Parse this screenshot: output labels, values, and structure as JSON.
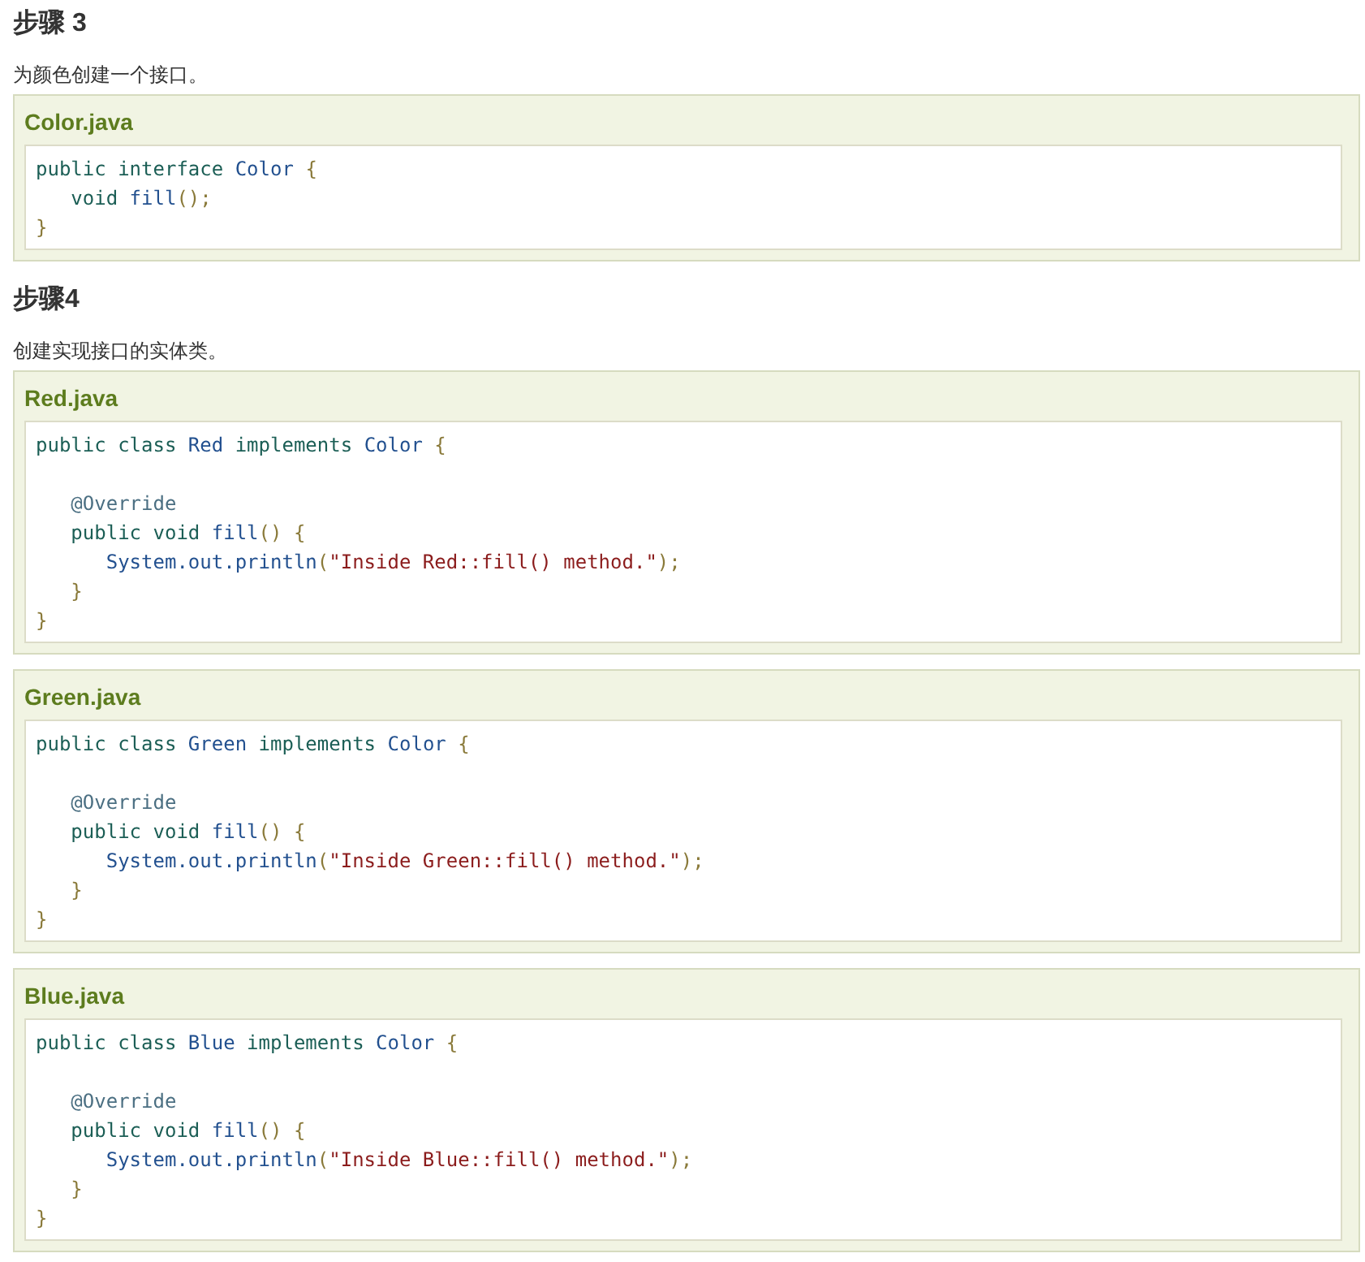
{
  "sections": [
    {
      "heading": "步骤 3",
      "text": "为颜色创建一个接口。",
      "examples": [
        {
          "title": "Color.java",
          "lines": [
            {
              "kind": "code",
              "tokens": [
                {
                  "kind": "kwd",
                  "text": "public interface "
                },
                {
                  "kind": "typ",
                  "text": "Color "
                },
                {
                  "kind": "pun",
                  "text": "{"
                }
              ],
              "children": [
                {
                  "kind": "code",
                  "tokens": [
                    {
                      "kind": "kwd",
                      "text": "void "
                    },
                    {
                      "kind": "typ",
                      "text": "fill"
                    },
                    {
                      "kind": "pun",
                      "text": "();"
                    }
                  ]
                }
              ]
            },
            {
              "kind": "code",
              "tokens": [
                {
                  "kind": "pun",
                  "text": "}"
                }
              ]
            }
          ]
        }
      ]
    },
    {
      "heading": "步骤4",
      "text": "创建实现接口的实体类。",
      "examples": [
        {
          "title": "Red.java",
          "lines": [
            {
              "kind": "code",
              "tokens": [
                {
                  "kind": "kwd",
                  "text": "public class "
                },
                {
                  "kind": "typ",
                  "text": "Red "
                },
                {
                  "kind": "kwd",
                  "text": "implements "
                },
                {
                  "kind": "typ",
                  "text": "Color "
                },
                {
                  "kind": "pun",
                  "text": "{"
                }
              ],
              "children": [
                {
                  "kind": "blank"
                },
                {
                  "kind": "code",
                  "tokens": [
                    {
                      "kind": "ann",
                      "text": "@Override"
                    }
                  ]
                },
                {
                  "kind": "code",
                  "tokens": [
                    {
                      "kind": "kwd",
                      "text": "public void "
                    },
                    {
                      "kind": "typ",
                      "text": "fill"
                    },
                    {
                      "kind": "pun",
                      "text": "() {"
                    }
                  ],
                  "children": [
                    {
                      "kind": "code",
                      "tokens": [
                        {
                          "kind": "typ",
                          "text": "System.out.println"
                        },
                        {
                          "kind": "pun",
                          "text": "("
                        },
                        {
                          "kind": "str",
                          "text": "\"Inside Red::fill() method.\""
                        },
                        {
                          "kind": "pun",
                          "text": ");"
                        }
                      ]
                    }
                  ]
                },
                {
                  "kind": "code",
                  "tokens": [
                    {
                      "kind": "pun",
                      "text": "}"
                    }
                  ]
                }
              ]
            },
            {
              "kind": "code",
              "tokens": [
                {
                  "kind": "pun",
                  "text": "}"
                }
              ]
            }
          ]
        },
        {
          "title": "Green.java",
          "lines": [
            {
              "kind": "code",
              "tokens": [
                {
                  "kind": "kwd",
                  "text": "public class "
                },
                {
                  "kind": "typ",
                  "text": "Green "
                },
                {
                  "kind": "kwd",
                  "text": "implements "
                },
                {
                  "kind": "typ",
                  "text": "Color "
                },
                {
                  "kind": "pun",
                  "text": "{"
                }
              ],
              "children": [
                {
                  "kind": "blank"
                },
                {
                  "kind": "code",
                  "tokens": [
                    {
                      "kind": "ann",
                      "text": "@Override"
                    }
                  ]
                },
                {
                  "kind": "code",
                  "tokens": [
                    {
                      "kind": "kwd",
                      "text": "public void "
                    },
                    {
                      "kind": "typ",
                      "text": "fill"
                    },
                    {
                      "kind": "pun",
                      "text": "() {"
                    }
                  ],
                  "children": [
                    {
                      "kind": "code",
                      "tokens": [
                        {
                          "kind": "typ",
                          "text": "System.out.println"
                        },
                        {
                          "kind": "pun",
                          "text": "("
                        },
                        {
                          "kind": "str",
                          "text": "\"Inside Green::fill() method.\""
                        },
                        {
                          "kind": "pun",
                          "text": ");"
                        }
                      ]
                    }
                  ]
                },
                {
                  "kind": "code",
                  "tokens": [
                    {
                      "kind": "pun",
                      "text": "}"
                    }
                  ]
                }
              ]
            },
            {
              "kind": "code",
              "tokens": [
                {
                  "kind": "pun",
                  "text": "}"
                }
              ]
            }
          ]
        },
        {
          "title": "Blue.java",
          "lines": [
            {
              "kind": "code",
              "tokens": [
                {
                  "kind": "kwd",
                  "text": "public class "
                },
                {
                  "kind": "typ",
                  "text": "Blue "
                },
                {
                  "kind": "kwd",
                  "text": "implements "
                },
                {
                  "kind": "typ",
                  "text": "Color "
                },
                {
                  "kind": "pun",
                  "text": "{"
                }
              ],
              "children": [
                {
                  "kind": "blank"
                },
                {
                  "kind": "code",
                  "tokens": [
                    {
                      "kind": "ann",
                      "text": "@Override"
                    }
                  ]
                },
                {
                  "kind": "code",
                  "tokens": [
                    {
                      "kind": "kwd",
                      "text": "public void "
                    },
                    {
                      "kind": "typ",
                      "text": "fill"
                    },
                    {
                      "kind": "pun",
                      "text": "() {"
                    }
                  ],
                  "children": [
                    {
                      "kind": "code",
                      "tokens": [
                        {
                          "kind": "typ",
                          "text": "System.out.println"
                        },
                        {
                          "kind": "pun",
                          "text": "("
                        },
                        {
                          "kind": "str",
                          "text": "\"Inside Blue::fill() method.\""
                        },
                        {
                          "kind": "pun",
                          "text": ");"
                        }
                      ]
                    }
                  ]
                },
                {
                  "kind": "code",
                  "tokens": [
                    {
                      "kind": "pun",
                      "text": "}"
                    }
                  ]
                }
              ]
            },
            {
              "kind": "code",
              "tokens": [
                {
                  "kind": "pun",
                  "text": "}"
                }
              ]
            }
          ]
        }
      ]
    }
  ]
}
